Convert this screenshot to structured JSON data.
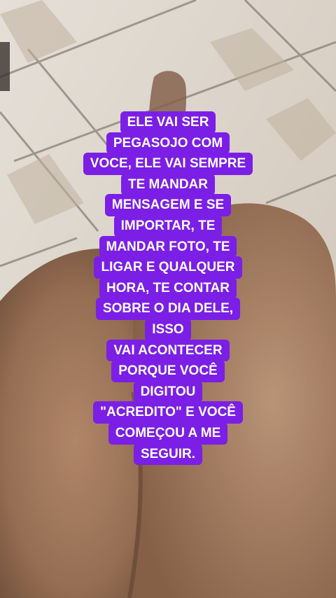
{
  "caption": {
    "lines": [
      "ELE VAI SER",
      "PEGASOJO COM",
      "VOCE, ELE VAI SEMPRE",
      "TE MANDAR",
      "MENSAGEM E SE",
      "IMPORTAR, TE",
      "MANDAR FOTO, TE",
      "LIGAR E QUALQUER",
      "HORA, TE CONTAR",
      "SOBRE O DIA DELE,",
      "ISSO",
      "VAI ACONTECER",
      "PORQUE VOCÊ",
      "DIGITOU",
      "\"ACREDITO\" E VOCÊ",
      "COMEÇOU A ME",
      "SEGUIR."
    ],
    "background_color": "#7b1fe6",
    "text_color": "#ffffff"
  },
  "photo": {
    "scene": "tiled-floor-with-legs-photo"
  }
}
